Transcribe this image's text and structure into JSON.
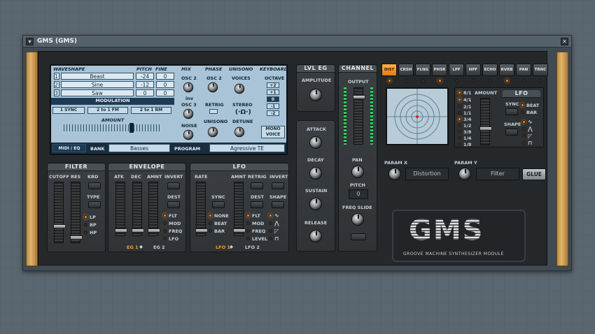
{
  "window": {
    "title": "GMS (GMS)"
  },
  "lcd": {
    "headers": {
      "waveshape": "WAVESHAPE",
      "pitch": "PITCH",
      "fine": "FINE",
      "mix": "MIX",
      "phase": "PHASE",
      "unisono": "UNISONO",
      "keyboard": "KEYBOARD"
    },
    "osc": [
      {
        "num": "1",
        "wave": "Beast",
        "pitch": "-24",
        "fine": "0"
      },
      {
        "num": "2",
        "wave": "Sine",
        "pitch": "-12",
        "fine": "0"
      },
      {
        "num": "3",
        "wave": "Saw",
        "pitch": "0",
        "fine": "0"
      }
    ],
    "modulation": "MODULATION",
    "mod_buttons": [
      "1 SYNC",
      "2 to 1 FM",
      "2 to 1 RM"
    ],
    "amount": "AMOUNT",
    "mix_labels": {
      "osc2": "OSC 2",
      "inv": "inv",
      "osc3": "OSC 3",
      "noise": "NOISE"
    },
    "phase_labels": {
      "osc2": "OSC 2",
      "retrig": "RETRIG",
      "unisono": "UNISONO"
    },
    "unisono_labels": {
      "voices": "VOICES",
      "stereo": "STEREO",
      "detune": "DETUNE"
    },
    "keyboard": {
      "octave": "OCTAVE",
      "values": [
        "+2",
        "+1",
        "0",
        "-1",
        "-2"
      ],
      "mono": "MONO VOICE"
    },
    "bottom": {
      "midi": "MIDI / EQ",
      "bank_label": "BANK",
      "bank": "Basses",
      "program_label": "PROGRAM",
      "program": "Agressive TE"
    }
  },
  "filter": {
    "title": "FILTER",
    "cutoff": "CUTOFF",
    "res": "RES",
    "kbd": "KBD",
    "type": "TYPE",
    "types": [
      "LP",
      "BP",
      "HP"
    ]
  },
  "envelope": {
    "title": "ENVELOPE",
    "atk": "ATK",
    "dec": "DEC",
    "amnt": "AMNT",
    "invert": "INVERT",
    "dest": "DEST",
    "dests": [
      "FLT",
      "MOD",
      "FREQ",
      "LFO"
    ],
    "eg1": "EG 1",
    "eg2": "EG 2"
  },
  "lfo": {
    "title": "LFO",
    "rate": "RATE",
    "amnt": "AMNT",
    "retrig": "RETRIG",
    "invert": "INVERT",
    "sync": "SYNC",
    "syncs": [
      "NONE",
      "BEAT",
      "BAR"
    ],
    "dest": "DEST",
    "dests": [
      "FLT",
      "MOD",
      "FREQ",
      "LEVEL"
    ],
    "shape": "SHAPE",
    "lfo1": "LFO 1",
    "lfo2": "LFO 2"
  },
  "lvleg": {
    "title": "LVL EG",
    "amplitude": "AMPLITUDE",
    "attack": "ATTACK",
    "decay": "DECAY",
    "sustain": "SUSTAIN",
    "release": "RELEASE"
  },
  "channel": {
    "title": "CHANNEL",
    "output": "OUTPUT",
    "pan": "PAN",
    "pitch": "PITCH",
    "pitch_value": "0",
    "freq_slide": "FREQ SLIDE"
  },
  "fx": {
    "buttons": [
      "DIST",
      "CRSH",
      "FLNG",
      "PHSR",
      "LPF",
      "HPF",
      "ECHO",
      "RVRB",
      "PAN",
      "TRNC"
    ],
    "active": "DIST"
  },
  "fxpanel": {
    "divisions": [
      "8/1",
      "4/1",
      "2/1",
      "1/1",
      "3/4",
      "1/2",
      "3/8",
      "1/4",
      "1/8"
    ],
    "amount": "AMOUNT",
    "lfo": "LFO",
    "sync": "SYNC",
    "beat": "BEAT",
    "bar": "BAR",
    "shape": "SHAPE",
    "param_x": "PARAM X",
    "param_x_value": "Distortion",
    "param_y": "PARAM Y",
    "param_y_value": "Filter",
    "glue": "GLUE"
  },
  "logo": {
    "text": "GMS",
    "subtitle": "GROOVE MACHINE SYNTHESIZER MODULE"
  },
  "colors": {
    "accent": "#ff8a1c",
    "lcd": "#a9c4d6",
    "panel": "#25282b"
  }
}
